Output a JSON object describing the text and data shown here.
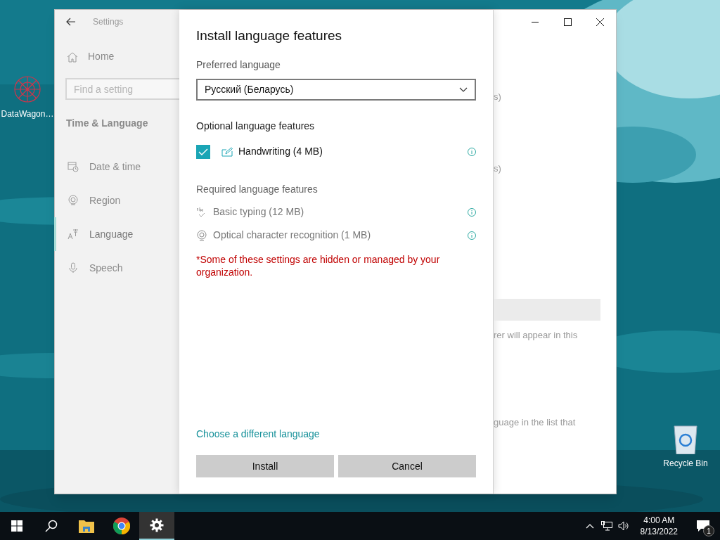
{
  "desktop_icons": [
    {
      "label": "DataWagon…"
    },
    {
      "label": "Recycle Bin"
    }
  ],
  "settings_window": {
    "title": "Settings",
    "sidebar": {
      "home": "Home",
      "search": {
        "placeholder": "Find a setting"
      },
      "section": "Time & Language",
      "items": [
        {
          "label": "Date & time",
          "selected": false
        },
        {
          "label": "Region",
          "selected": false
        },
        {
          "label": "Language",
          "selected": true
        },
        {
          "label": "Speech",
          "selected": false
        }
      ]
    },
    "background_fragments": [
      "s)",
      "s)",
      "rer will appear in this",
      "guage in the list that"
    ]
  },
  "dialog": {
    "title": "Install language features",
    "preferred_label": "Preferred language",
    "preferred_value": "Русский (Беларусь)",
    "optional_heading": "Optional language features",
    "optional_features": [
      {
        "label": "Handwriting (4 MB)",
        "checked": true
      }
    ],
    "required_heading": "Required language features",
    "required_features": [
      "Basic typing (12 MB)",
      "Optical character recognition (1 MB)"
    ],
    "notice": "*Some of these settings are hidden or managed by your organization.",
    "link": "Choose a different language",
    "buttons": [
      "Install",
      "Cancel"
    ]
  },
  "taskbar": {
    "apps": [
      {
        "kind": "search",
        "selected": false
      },
      {
        "kind": "folder",
        "selected": false
      },
      {
        "kind": "browser",
        "selected": false
      },
      {
        "kind": "settings",
        "selected": true
      }
    ],
    "time": "4:00 AM",
    "date": "8/13/2022",
    "notification_count": "1"
  }
}
